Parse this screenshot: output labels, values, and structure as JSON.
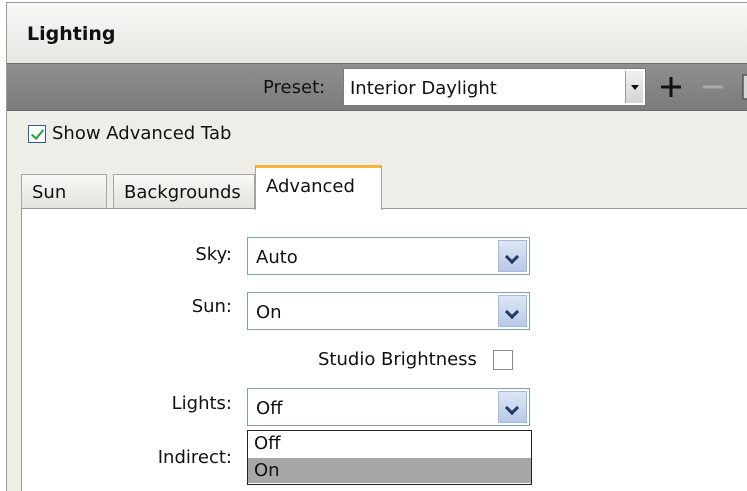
{
  "window": {
    "title": "Lighting"
  },
  "preset": {
    "label": "Preset:",
    "value": "Interior Daylight"
  },
  "show_advanced": {
    "label": "Show Advanced Tab",
    "checked": true
  },
  "tabs": [
    {
      "label": "Sun",
      "active": false
    },
    {
      "label": "Backgrounds",
      "active": false
    },
    {
      "label": "Advanced",
      "active": true
    }
  ],
  "advanced": {
    "sky": {
      "label": "Sky:",
      "value": "Auto"
    },
    "sun": {
      "label": "Sun:",
      "value": "On"
    },
    "studio_brightness": {
      "label": "Studio Brightness",
      "checked": false
    },
    "lights": {
      "label": "Lights:",
      "value": "Off"
    },
    "indirect": {
      "label": "Indirect:"
    }
  },
  "lights_dropdown": {
    "options": [
      "Off",
      "On"
    ],
    "highlighted": "On"
  },
  "colors": {
    "accent_tab": "#f7b33c",
    "check": "#22a232",
    "combo_border": "#7f9db9",
    "toolbar": "#858585",
    "panel_bg": "#eeede8"
  },
  "icons": {
    "add_preset": "plus-icon",
    "remove_preset": "minus-icon",
    "preset_page": "page-icon"
  }
}
